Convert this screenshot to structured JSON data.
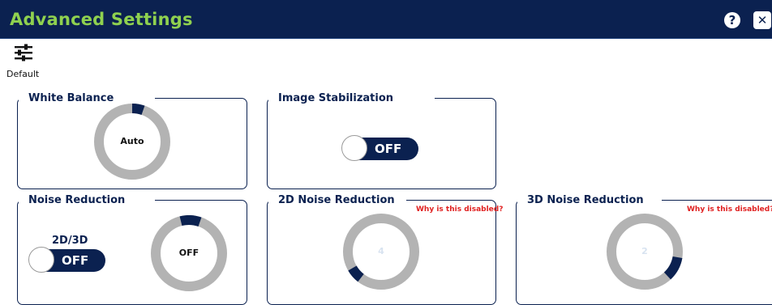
{
  "window": {
    "title": "Advanced Settings",
    "help": "?",
    "close": "✕"
  },
  "toolbar": {
    "default_label": "Default"
  },
  "panels": {
    "white_balance": {
      "title": "White Balance",
      "value": "Auto"
    },
    "image_stabilization": {
      "title": "Image Stabilization",
      "toggle": "OFF"
    },
    "noise_reduction": {
      "title": "Noise Reduction",
      "mode_label": "2D/3D",
      "toggle": "OFF",
      "value": "OFF"
    },
    "nr_2d": {
      "title": "2D Noise Reduction",
      "warning": "Why is this disabled?",
      "value": "4"
    },
    "nr_3d": {
      "title": "3D Noise Reduction",
      "warning": "Why is this disabled?",
      "value": "2"
    }
  },
  "colors": {
    "titlebar": "#0b2150",
    "title_text": "#8fd14f",
    "dial_track": "#b3b3b3",
    "dial_active": "#0b2150",
    "warning": "#e02020"
  }
}
